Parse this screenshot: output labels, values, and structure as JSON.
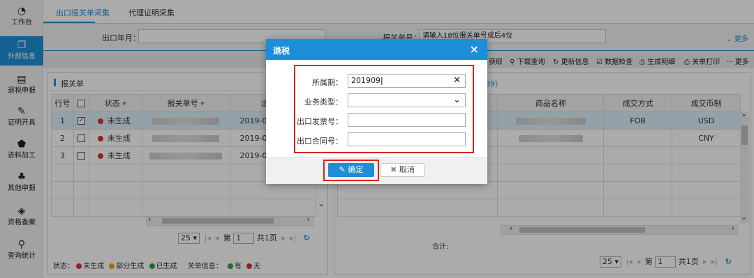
{
  "sidebar": {
    "items": [
      {
        "label": "工作台",
        "icon": "dashboard-icon",
        "glyph": "◔"
      },
      {
        "label": "外部信息",
        "icon": "windows-icon",
        "glyph": "❐",
        "active": true
      },
      {
        "label": "退税申报",
        "icon": "document-icon",
        "glyph": "▤"
      },
      {
        "label": "证明开具",
        "icon": "edit-icon",
        "glyph": "✎"
      },
      {
        "label": "进料加工",
        "icon": "shield-icon",
        "glyph": "⬟"
      },
      {
        "label": "其他申报",
        "icon": "org-chart-icon",
        "glyph": "♣"
      },
      {
        "label": "资格备案",
        "icon": "box-icon",
        "glyph": "◈"
      },
      {
        "label": "查询统计",
        "icon": "search-icon",
        "glyph": "⚲"
      }
    ]
  },
  "tabs": [
    {
      "label": "出口报关单采集",
      "active": true
    },
    {
      "label": "代理证明采集",
      "active": false
    }
  ],
  "filter": {
    "export_month_label": "出口年月：",
    "customs_no_label": "报关单号：",
    "customs_no_value": "请输入18位报关单号或后4位",
    "more_label": "更多"
  },
  "toolbar": {
    "buttons": [
      "获取",
      "下载查询",
      "更新信息",
      "数据检查",
      "生成明细",
      "关单打印",
      "更多"
    ]
  },
  "left_panel": {
    "title": "报关单",
    "columns": [
      "行号",
      "",
      "状态",
      "报关单号",
      "出口日"
    ],
    "rows": [
      {
        "num": "1",
        "checked": true,
        "status": "未生成",
        "date": "2019-0"
      },
      {
        "num": "2",
        "checked": false,
        "status": "未生成",
        "date": "2019-0"
      },
      {
        "num": "3",
        "checked": false,
        "status": "未生成",
        "date": "2019-0"
      }
    ],
    "pager": {
      "size": "25",
      "page_prefix": "第",
      "page": "1",
      "total": "共1页"
    },
    "legend": {
      "status_label": "状态：",
      "s1": "未生成",
      "s2": "部分生成",
      "s3": "已生成",
      "info_label": "关单信息：",
      "i1": "有",
      "i2": "无"
    }
  },
  "right_panel": {
    "title_fragment": "89）",
    "columns": [
      "商品名称",
      "成交方式",
      "成交币制"
    ],
    "rows": [
      {
        "method": "FOB",
        "currency": "USD"
      },
      {
        "method": "",
        "currency": "CNY"
      }
    ],
    "total_label": "合计:",
    "pager": {
      "size": "25",
      "page_prefix": "第",
      "page": "1",
      "total": "共1页"
    }
  },
  "dialog": {
    "title": "退税",
    "close": "×",
    "fields": {
      "period": {
        "label": "所属期：",
        "value": "201909"
      },
      "business_type": {
        "label": "业务类型：",
        "value": ""
      },
      "invoice_no": {
        "label": "出口发票号：",
        "value": ""
      },
      "contract_no": {
        "label": "出口合同号：",
        "value": ""
      }
    },
    "ok_label": "确定",
    "cancel_label": "取消"
  },
  "colors": {
    "accent": "#1d8fd8",
    "status_red": "#d9332b",
    "status_orange": "#f0a020",
    "status_green": "#2ea043",
    "highlight_red": "#e02020"
  }
}
